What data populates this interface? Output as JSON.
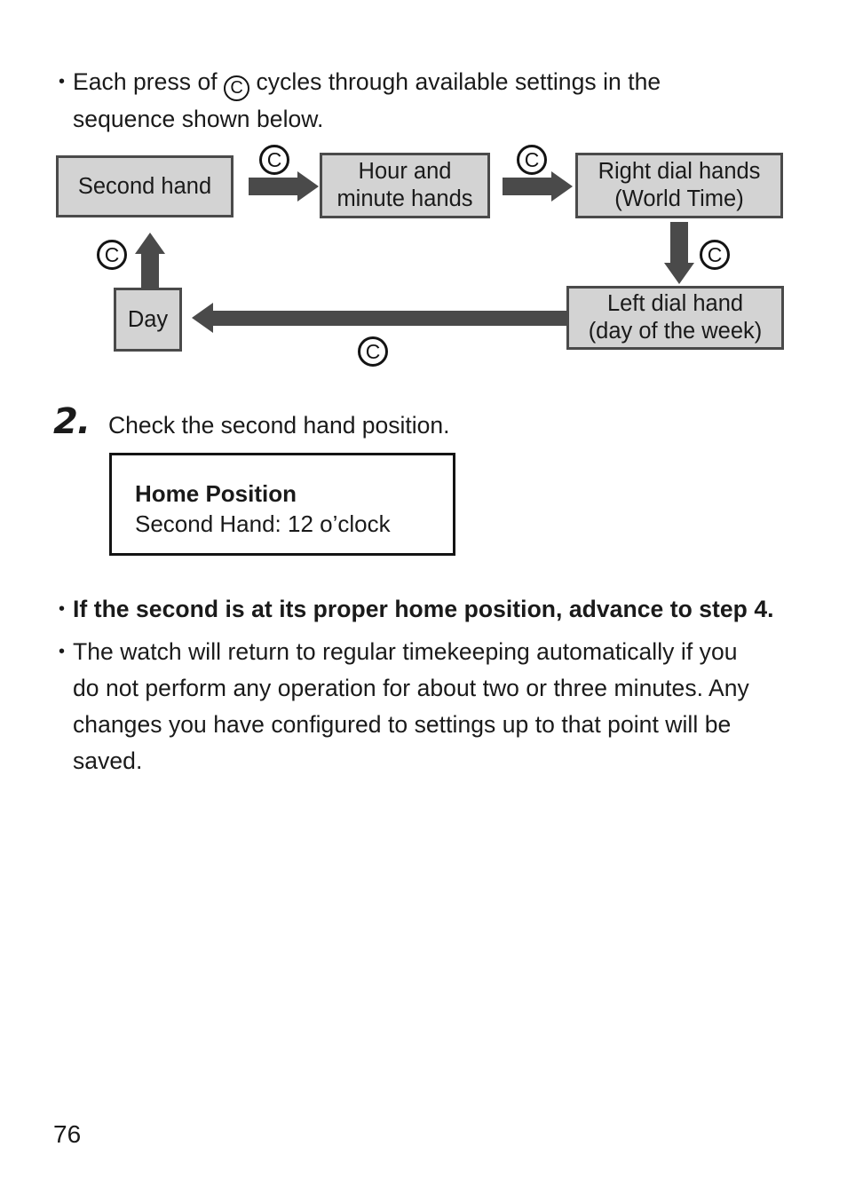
{
  "intro": {
    "bullet": "•",
    "line1_pre": "Each press of ",
    "button_symbol": "C",
    "line1_post": " cycles through available settings in the",
    "line2": "sequence shown below."
  },
  "flowchart": {
    "boxes": [
      {
        "id": "second-hand",
        "label": "Second hand"
      },
      {
        "id": "hour-minute-hands",
        "line1": "Hour and",
        "line2": "minute hands"
      },
      {
        "id": "right-dial-hands",
        "line1": "Right dial hands",
        "line2": "(World Time)"
      },
      {
        "id": "left-dial-hand",
        "line1": "Left dial hand",
        "line2": "(day of the week)"
      },
      {
        "id": "day",
        "label": "Day"
      }
    ],
    "button_labels": {
      "top_left": "C",
      "top_right": "C",
      "right_down": "C",
      "bottom": "C",
      "left_up": "C"
    }
  },
  "step_two": {
    "number": "2.",
    "text": "Check the second hand position."
  },
  "home_position": {
    "title": "Home Position",
    "detail": "Second Hand: 12 o’clock"
  },
  "notes": [
    {
      "bullet": "•",
      "bold": true,
      "lines": [
        "If the second is at its proper home position, advance to step 4."
      ]
    },
    {
      "bullet": "•",
      "bold": false,
      "lines": [
        "The watch will return to regular timekeeping automatically if you",
        "do not perform any operation for about two or three minutes. Any",
        "changes you have configured to settings up to that point will be",
        "saved."
      ]
    }
  ],
  "page_number": "76",
  "colors": {
    "box_fill": "#d3d3d3",
    "box_border": "#4a4a4a",
    "arrow": "#4a4a4a",
    "text": "#1a1a1a"
  }
}
